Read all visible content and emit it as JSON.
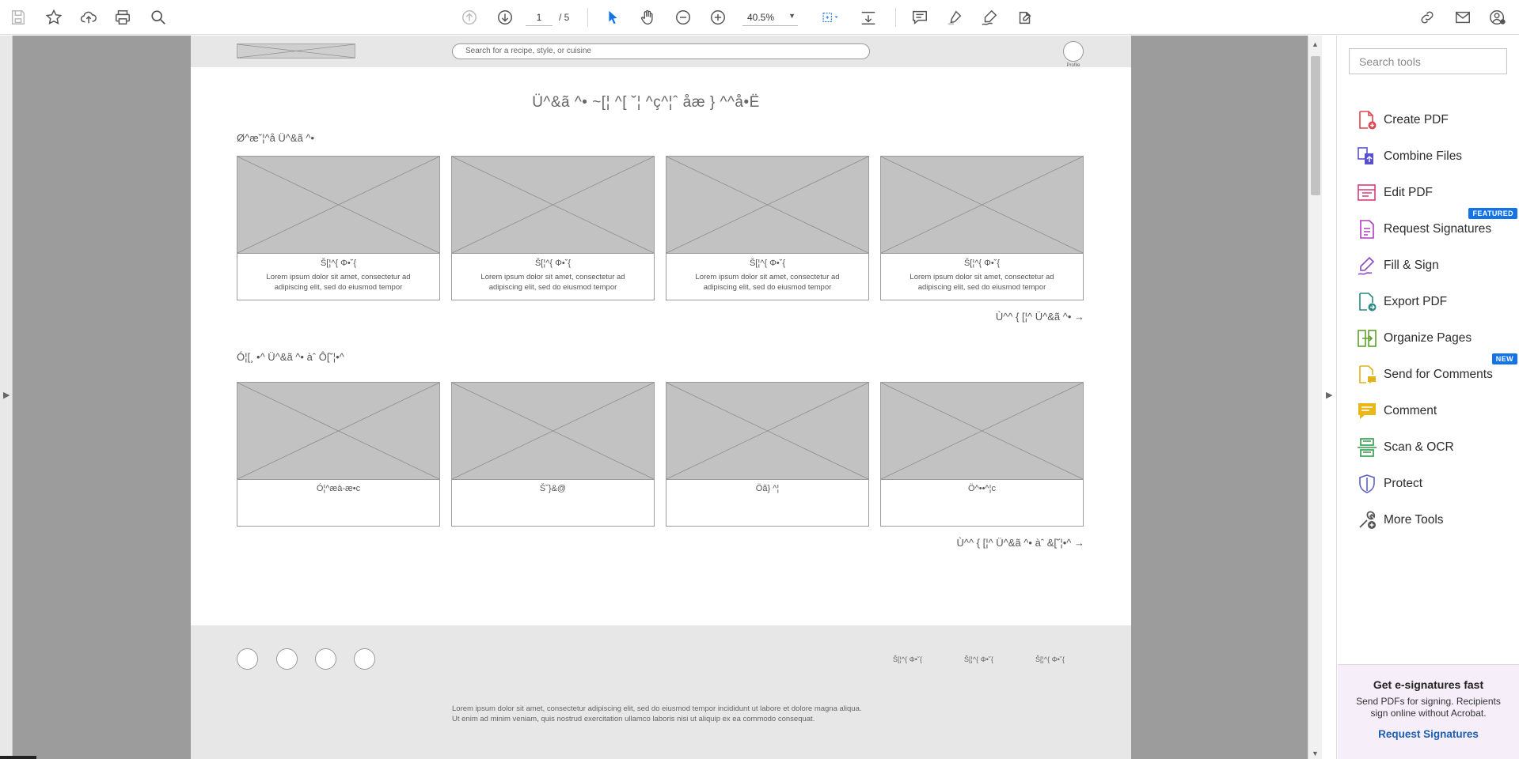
{
  "toolbar": {
    "icons": [
      "save-icon",
      "bookmark-star-icon",
      "cloud-upload-icon",
      "print-icon",
      "search-zoom-icon",
      "arrow-up-icon",
      "arrow-down-icon",
      "select-cursor-icon",
      "hand-pan-icon",
      "zoom-out-icon",
      "zoom-in-icon",
      "marquee-zoom-icon",
      "scroll-mode-icon",
      "comment-icon",
      "highlighter-icon",
      "sign-pen-icon",
      "fill-sign-icon",
      "share-link-icon",
      "email-icon",
      "account-icon"
    ],
    "current_page": "1",
    "total_pages": "/ 5",
    "zoom": "40.5%"
  },
  "document": {
    "page_content": {
      "search_placeholder": "Search for a recipe, style, or cuisine",
      "profile_label": "Profile",
      "page_title": "Ü^&ã ^• ~[¦ ^[ ˘¦ ^ç^¦ˆ åæ } ^^å•Ë",
      "section1": {
        "title": "Ø^æ˘¦^å Ü^&ã ^•",
        "cards": [
          {
            "title": "Š[¦^{ Φ•˘{",
            "desc": "Lorem ipsum dolor sit amet, consectetur ad adipiscing elit, sed do eiusmod tempor"
          },
          {
            "title": "Š[¦^{ Φ•˘{",
            "desc": "Lorem ipsum dolor sit amet, consectetur ad adipiscing elit, sed do eiusmod tempor"
          },
          {
            "title": "Š[¦^{ Φ•˘{",
            "desc": "Lorem ipsum dolor sit amet, consectetur ad adipiscing elit, sed do eiusmod tempor"
          },
          {
            "title": "Š[¦^{ Φ•˘{",
            "desc": "Lorem ipsum dolor sit amet, consectetur ad adipiscing elit, sed do eiusmod tempor"
          }
        ],
        "see_more": "Ù^^ { [¦^ Ü^&ã ^• →"
      },
      "section2": {
        "title": "Ó¦[¸ •^ Ü^&ã ^• àˆ Ô[˘¦•^",
        "cards": [
          {
            "title": "Ó¦^æà-æ•c"
          },
          {
            "title": "Š˘}&@"
          },
          {
            "title": "Öã} ^¦"
          },
          {
            "title": "Ö^••^¦c"
          }
        ],
        "see_more": "Ù^^ { [¦^ Ü^&ã ^• àˆ &[˘¦•^ →"
      },
      "footer": {
        "links": [
          "Š[¦^{ Φ•˘{",
          "Š[¦^{ Φ•˘{",
          "Š[¦^{ Φ•˘{"
        ],
        "legal": "Lorem ipsum dolor sit amet, consectetur adipiscing elit, sed do eiusmod tempor incididunt ut labore et dolore magna aliqua. Ut enim ad minim veniam, quis nostrud exercitation ullamco laboris nisi ut aliquip ex ea commodo consequat."
      }
    }
  },
  "tools_pane": {
    "search_placeholder": "Search tools",
    "items": [
      {
        "label": "Create PDF",
        "icon": "create-pdf-icon",
        "color": "#e0454d"
      },
      {
        "label": "Combine Files",
        "icon": "combine-files-icon",
        "color": "#5a4fd1"
      },
      {
        "label": "Edit PDF",
        "icon": "edit-pdf-icon",
        "color": "#d83b78"
      },
      {
        "label": "Request Signatures",
        "icon": "request-signatures-icon",
        "color": "#b13cbf",
        "badge": "FEATURED"
      },
      {
        "label": "Fill & Sign",
        "icon": "fill-sign-icon",
        "color": "#8d48c2"
      },
      {
        "label": "Export PDF",
        "icon": "export-pdf-icon",
        "color": "#2a8a84"
      },
      {
        "label": "Organize Pages",
        "icon": "organize-pages-icon",
        "color": "#5ea22b"
      },
      {
        "label": "Send for Comments",
        "icon": "send-for-comments-icon",
        "color": "#e0b31a",
        "badge": "NEW"
      },
      {
        "label": "Comment",
        "icon": "comment-icon",
        "color": "#e8b71b"
      },
      {
        "label": "Scan & OCR",
        "icon": "scan-ocr-icon",
        "color": "#2f9c4a"
      },
      {
        "label": "Protect",
        "icon": "protect-icon",
        "color": "#5d5fc9"
      },
      {
        "label": "More Tools",
        "icon": "more-tools-icon",
        "color": "#555555"
      }
    ],
    "promo": {
      "title": "Get e-signatures fast",
      "text": "Send PDFs for signing. Recipients sign online without Acrobat.",
      "link": "Request Signatures"
    }
  },
  "colors": {
    "accent_blue": "#1473e6",
    "link_blue": "#1b5fb3",
    "canvas_gray": "#9c9c9c",
    "wireframe_gray": "#c2c2c2"
  }
}
